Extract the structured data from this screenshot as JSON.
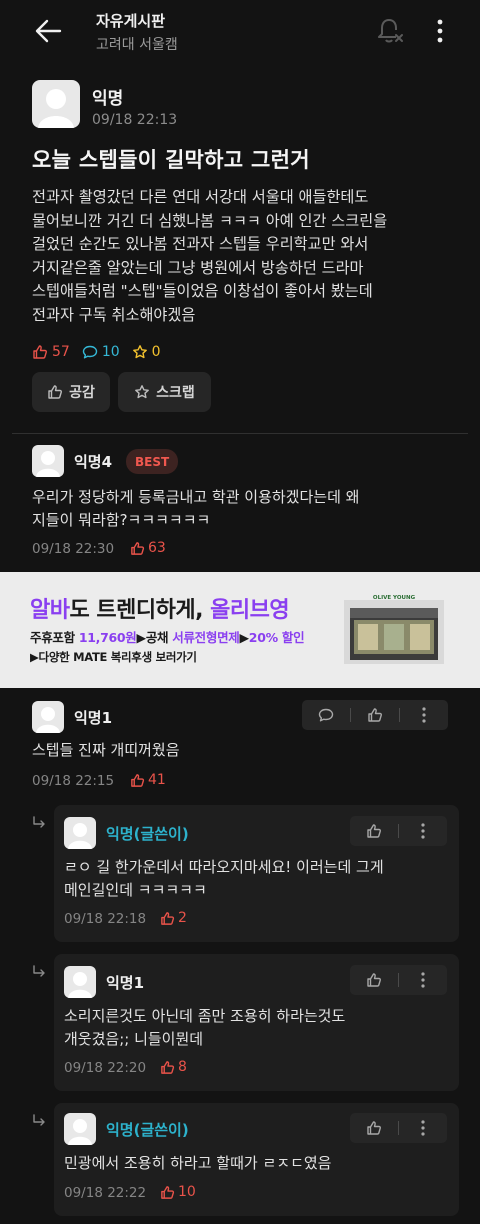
{
  "header": {
    "title": "자유게시판",
    "subtitle": "고려대 서울캠"
  },
  "post": {
    "author": "익명",
    "time": "09/18 22:13",
    "title": "오늘 스텝들이 길막하고 그런거",
    "body": "전과자 촬영갔던 다른 연대 서강대 서울대 애들한테도\n물어보니깐 거긴 더 심했나봄 ㅋㅋㅋ 아예 인간 스크린을\n걸었던 순간도 있나봄 전과자 스텝들 우리학교만 와서\n거지같은줄 알았는데 그냥 병원에서 방송하던 드라마\n스텝애들처럼 \"스텝\"들이었음 이창섭이 좋아서 봤는데\n전과자 구독 취소해야겠음",
    "likes": "57",
    "comments": "10",
    "scraps": "0",
    "like_button": "공감",
    "scrap_button": "스크랩"
  },
  "best_comment": {
    "author": "익명4",
    "badge": "BEST",
    "text": "우리가 정당하게 등록금내고 학관 이용하겠다는데 왜\n지들이 뭐라함?ㅋㅋㅋㅋㅋㅋ",
    "time": "09/18 22:30",
    "likes": "63"
  },
  "ad": {
    "headline_a": "알바",
    "headline_b": "도 트렌디하게, ",
    "headline_c": "올리브영",
    "line2_a": "주휴포함 ",
    "line2_b": "11,760원",
    "line2_c": "▶공채 ",
    "line2_d": "서류전형면제",
    "line2_e": "▶",
    "line2_f": "20% 할인",
    "line3": "▶다양한 MATE 복리후생 보러가기",
    "store_sign": "OLIVE YOUNG"
  },
  "comments": [
    {
      "author": "익명1",
      "text": "스텝들 진짜 개띠꺼웠음",
      "time": "09/18 22:15",
      "likes": "41"
    }
  ],
  "replies": [
    {
      "author": "익명(글쓴이)",
      "text": "ㄹㅇ 길 한가운데서 따라오지마세요! 이러는데 그게\n메인길인데 ㅋㅋㅋㅋㅋ",
      "time": "09/18 22:18",
      "likes": "2"
    },
    {
      "author": "익명1",
      "text": "소리지른것도 아닌데 좀만 조용히 하라는것도\n개웃겼음;; 니들이뭔데",
      "time": "09/18 22:20",
      "likes": "8"
    },
    {
      "author": "익명(글쓴이)",
      "text": "민광에서 조용히 하라고 할때가 ㄹㅈㄷ였음",
      "time": "09/18 22:22",
      "likes": "10"
    }
  ]
}
